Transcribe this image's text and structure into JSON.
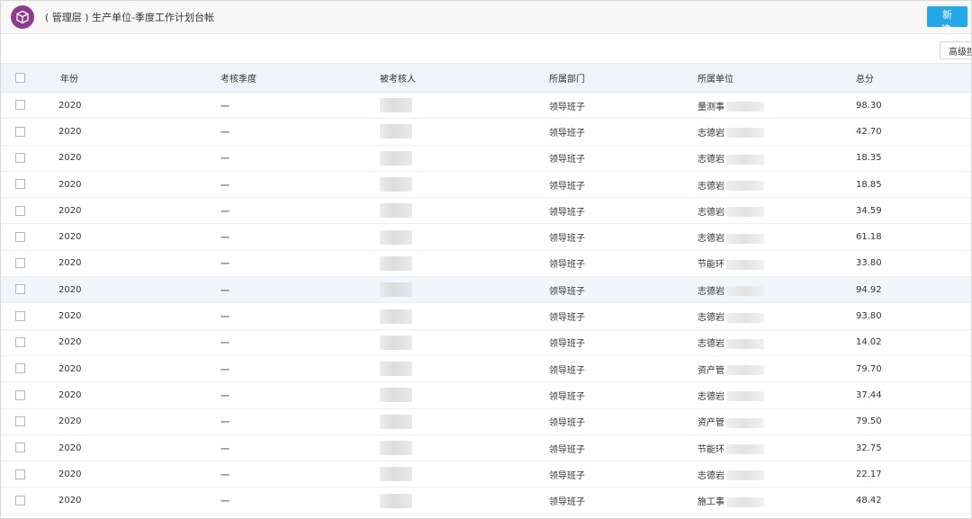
{
  "header": {
    "title": "( 管理层 ) 生产单位-季度工作计划台帐",
    "new_button": "新 建"
  },
  "toolbar": {
    "advanced_button": "高级搜"
  },
  "table": {
    "columns": [
      "年份",
      "考核季度",
      "被考核人",
      "所属部门",
      "所属单位",
      "总分"
    ],
    "rows": [
      {
        "year": "2020",
        "quarter": "一",
        "dept": "领导班子",
        "unit": "量测事",
        "score": "98.30"
      },
      {
        "year": "2020",
        "quarter": "一",
        "dept": "领导班子",
        "unit": "志德岩",
        "score": "42.70"
      },
      {
        "year": "2020",
        "quarter": "一",
        "dept": "领导班子",
        "unit": "志德岩",
        "score": "18.35"
      },
      {
        "year": "2020",
        "quarter": "一",
        "dept": "领导班子",
        "unit": "志德岩",
        "score": "18.85"
      },
      {
        "year": "2020",
        "quarter": "一",
        "dept": "领导班子",
        "unit": "志德岩",
        "score": "34.59"
      },
      {
        "year": "2020",
        "quarter": "一",
        "dept": "领导班子",
        "unit": "志德岩",
        "score": "61.18"
      },
      {
        "year": "2020",
        "quarter": "一",
        "dept": "领导班子",
        "unit": "节能环",
        "score": "33.80"
      },
      {
        "year": "2020",
        "quarter": "一",
        "dept": "领导班子",
        "unit": "志德岩",
        "score": "94.92"
      },
      {
        "year": "2020",
        "quarter": "一",
        "dept": "领导班子",
        "unit": "志德岩",
        "score": "93.80"
      },
      {
        "year": "2020",
        "quarter": "一",
        "dept": "领导班子",
        "unit": "志德岩",
        "score": "14.02"
      },
      {
        "year": "2020",
        "quarter": "一",
        "dept": "领导班子",
        "unit": "资产管",
        "score": "79.70"
      },
      {
        "year": "2020",
        "quarter": "一",
        "dept": "领导班子",
        "unit": "志德岩",
        "score": "37.44"
      },
      {
        "year": "2020",
        "quarter": "一",
        "dept": "领导班子",
        "unit": "资产管",
        "score": "79.50"
      },
      {
        "year": "2020",
        "quarter": "一",
        "dept": "领导班子",
        "unit": "节能环",
        "score": "32.75"
      },
      {
        "year": "2020",
        "quarter": "一",
        "dept": "领导班子",
        "unit": "志德岩",
        "score": "22.17"
      },
      {
        "year": "2020",
        "quarter": "一",
        "dept": "领导班子",
        "unit": "施工事",
        "score": "48.42"
      }
    ],
    "highlighted_row": 7
  },
  "colors": {
    "accent": "#24a8e8",
    "logo": "#8e3a8e",
    "header_bg": "#eef4fa"
  }
}
